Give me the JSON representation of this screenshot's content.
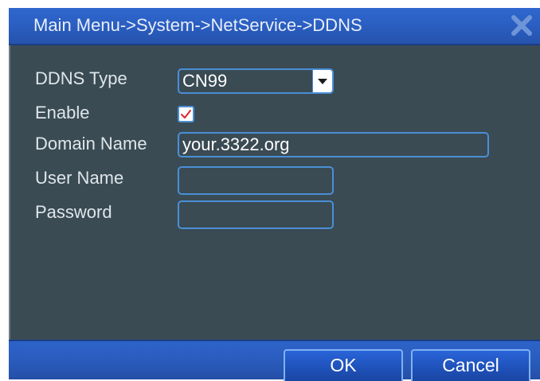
{
  "window": {
    "title": "Main Menu->System->NetService->DDNS",
    "close_icon": "close-x-icon"
  },
  "form": {
    "ddns_type": {
      "label": "DDNS Type",
      "value": "CN99",
      "icon": "chevron-down-icon"
    },
    "enable": {
      "label": "Enable",
      "checked": true
    },
    "domain_name": {
      "label": "Domain Name",
      "value": "your.3322.org"
    },
    "user_name": {
      "label": "User Name",
      "value": ""
    },
    "password": {
      "label": "Password",
      "value": ""
    }
  },
  "footer": {
    "ok_label": "OK",
    "cancel_label": "Cancel"
  },
  "colors": {
    "titlebar": "#2b5fc2",
    "body": "#3a4b54",
    "field_border": "#4a8fd6",
    "check_mark": "#e0262b"
  }
}
